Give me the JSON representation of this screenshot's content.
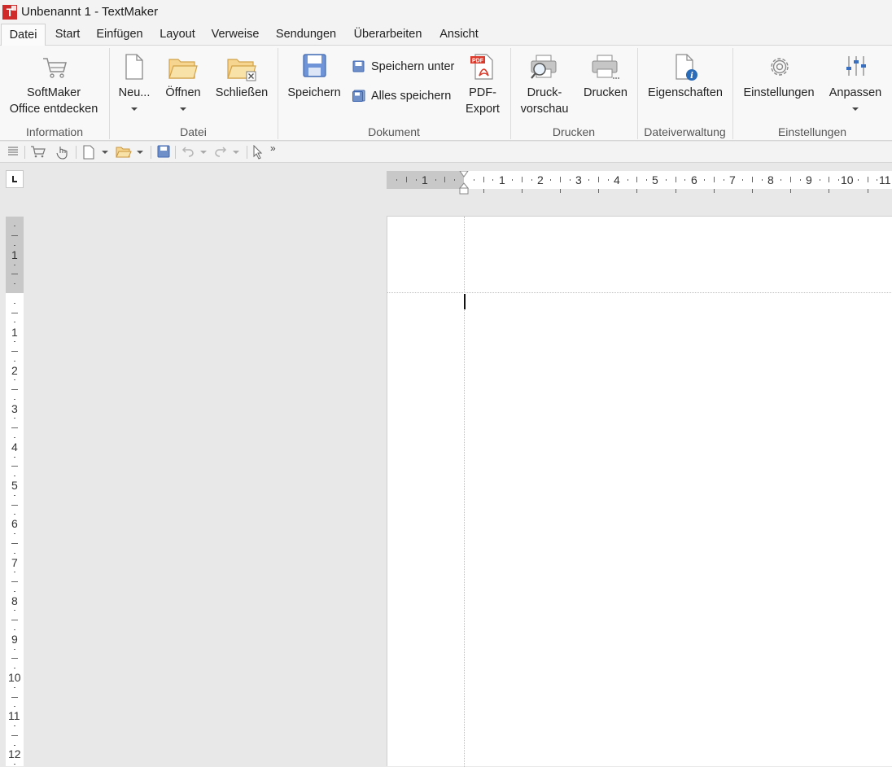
{
  "window": {
    "title": "Unbenannt 1 - TextMaker",
    "app_icon_letter": "T"
  },
  "menu_tabs": [
    "Datei",
    "Start",
    "Einfügen",
    "Layout",
    "Verweise",
    "Sendungen",
    "Überarbeiten",
    "Ansicht"
  ],
  "active_tab": "Datei",
  "ribbon": {
    "groups": {
      "information": "Information",
      "datei": "Datei",
      "dokument": "Dokument",
      "drucken": "Drucken",
      "dateiverwaltung": "Dateiverwaltung",
      "einstellungen": "Einstellungen"
    },
    "buttons": {
      "softmaker_line1": "SoftMaker",
      "softmaker_line2": "Office entdecken",
      "neu": "Neu...",
      "oeffnen": "Öffnen",
      "schliessen": "Schließen",
      "speichern": "Speichern",
      "speichern_unter": "Speichern unter",
      "alles_speichern": "Alles speichern",
      "pdf_line1": "PDF-",
      "pdf_line2": "Export",
      "druckvorschau_line1": "Druck-",
      "druckvorschau_line2": "vorschau",
      "drucken": "Drucken",
      "eigenschaften": "Eigenschaften",
      "einstellungen": "Einstellungen",
      "anpassen": "Anpassen"
    }
  },
  "qat_overflow": "»",
  "horizontal_ruler": {
    "left_labels": [
      "1"
    ],
    "labels": [
      "1",
      "2",
      "3",
      "4",
      "5",
      "6",
      "7",
      "8",
      "9",
      "10",
      "11"
    ]
  },
  "vertical_ruler": {
    "top_labels": [
      "1"
    ],
    "labels": [
      "1",
      "2",
      "3",
      "4",
      "5",
      "6",
      "7",
      "8",
      "9",
      "10",
      "11",
      "12"
    ]
  },
  "colors": {
    "accent": "#2b579a",
    "folder": "#f0c36d",
    "app_red": "#cf2b2b"
  }
}
